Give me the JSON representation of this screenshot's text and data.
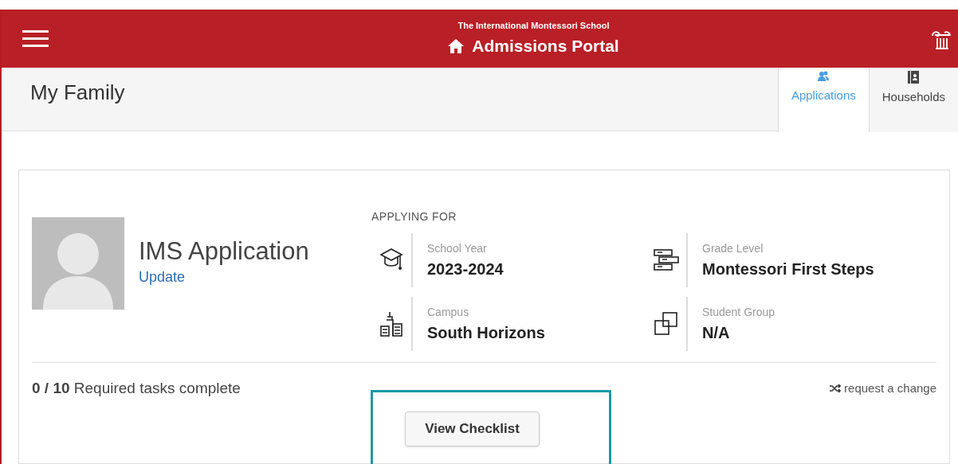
{
  "header": {
    "school": "The International Montessori School",
    "title": "Admissions Portal"
  },
  "page_title": "My Family",
  "tabs": [
    {
      "label": "Applications",
      "selected": true,
      "kind": "people"
    },
    {
      "label": "Households",
      "selected": false,
      "kind": "book"
    }
  ],
  "application": {
    "name": "IMS Application",
    "update_link": "Update",
    "section_label": "APPLYING FOR",
    "fields": [
      {
        "label": "School Year",
        "value": "2023-2024",
        "kind": "cap"
      },
      {
        "label": "Grade Level",
        "value": "Montessori First Steps",
        "kind": "levels"
      },
      {
        "label": "Campus",
        "value": "South Horizons",
        "kind": "building"
      },
      {
        "label": "Student Group",
        "value": "N/A",
        "kind": "squares"
      }
    ],
    "progress_count": "0 / 10",
    "progress_text": "Required tasks complete",
    "change_link": "request a change",
    "button": "View Checklist"
  }
}
